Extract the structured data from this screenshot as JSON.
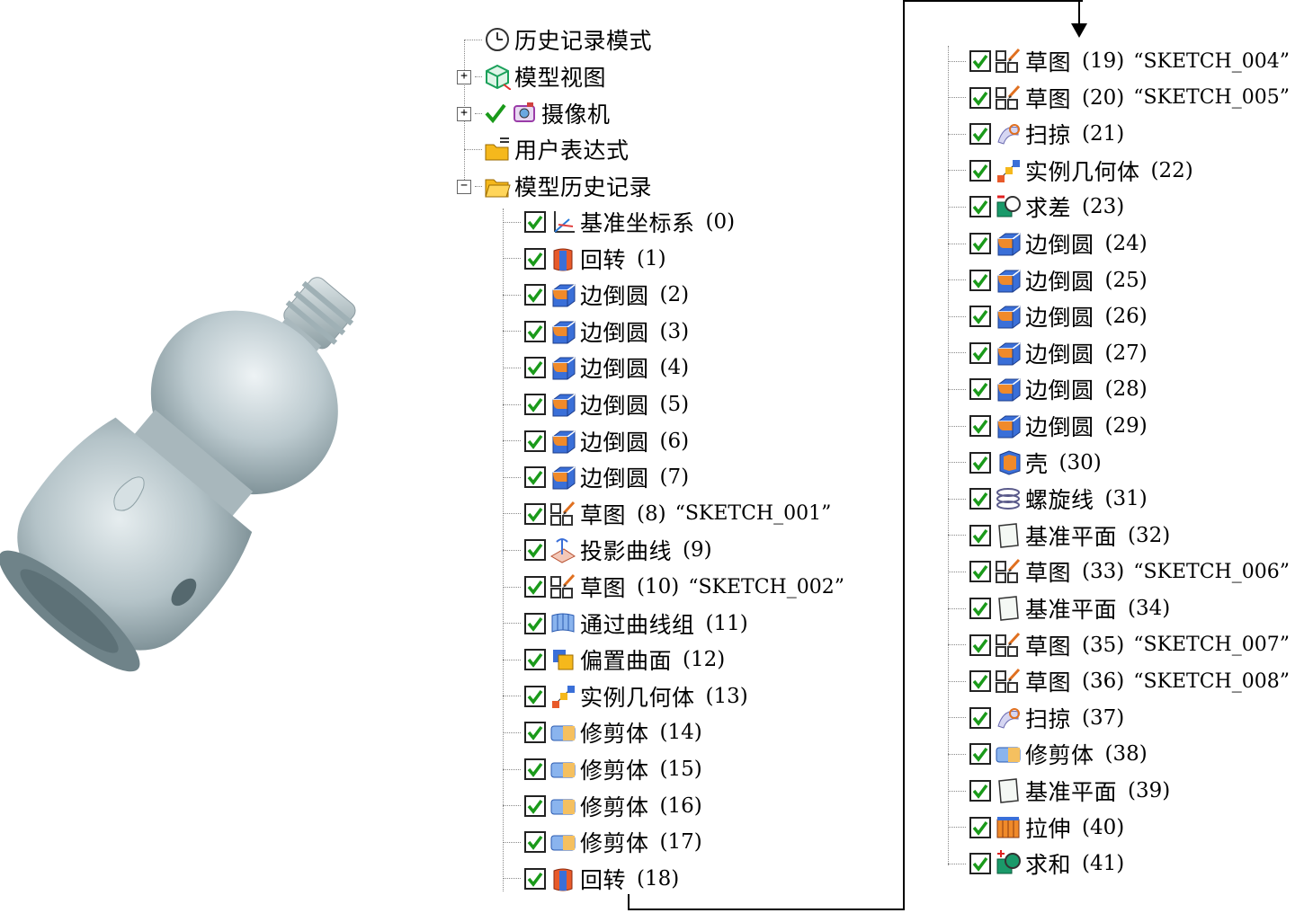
{
  "top_nodes": [
    {
      "label": "历史记录模式",
      "icon": "clock-icon",
      "expander": null
    },
    {
      "label": "模型视图",
      "icon": "model-view-icon",
      "expander": "+"
    },
    {
      "label": "摄像机",
      "icon": "camera-icon",
      "expander": "+",
      "checked": true
    },
    {
      "label": "用户表达式",
      "icon": "folder-icon",
      "expander": null
    },
    {
      "label": "模型历史记录",
      "icon": "folder-open-icon",
      "expander": "−"
    }
  ],
  "features_left": [
    {
      "name": "基准坐标系",
      "num": "(0)",
      "icon": "datum-csys-icon"
    },
    {
      "name": "回转",
      "num": "(1)",
      "icon": "revolve-icon"
    },
    {
      "name": "边倒圆",
      "num": "(2)",
      "icon": "edge-blend-icon"
    },
    {
      "name": "边倒圆",
      "num": "(3)",
      "icon": "edge-blend-icon"
    },
    {
      "name": "边倒圆",
      "num": "(4)",
      "icon": "edge-blend-icon"
    },
    {
      "name": "边倒圆",
      "num": "(5)",
      "icon": "edge-blend-icon"
    },
    {
      "name": "边倒圆",
      "num": "(6)",
      "icon": "edge-blend-icon"
    },
    {
      "name": "边倒圆",
      "num": "(7)",
      "icon": "edge-blend-icon"
    },
    {
      "name": "草图",
      "num": "(8)",
      "sketch": "“SKETCH_001”",
      "icon": "sketch-icon"
    },
    {
      "name": "投影曲线",
      "num": "(9)",
      "icon": "project-curve-icon"
    },
    {
      "name": "草图",
      "num": "(10)",
      "sketch": "“SKETCH_002”",
      "icon": "sketch-icon"
    },
    {
      "name": "通过曲线组",
      "num": "(11)",
      "icon": "through-curves-icon"
    },
    {
      "name": "偏置曲面",
      "num": "(12)",
      "icon": "offset-surface-icon"
    },
    {
      "name": "实例几何体",
      "num": "(13)",
      "icon": "instance-geometry-icon"
    },
    {
      "name": "修剪体",
      "num": "(14)",
      "icon": "trim-body-icon"
    },
    {
      "name": "修剪体",
      "num": "(15)",
      "icon": "trim-body-icon"
    },
    {
      "name": "修剪体",
      "num": "(16)",
      "icon": "trim-body-icon"
    },
    {
      "name": "修剪体",
      "num": "(17)",
      "icon": "trim-body-icon"
    },
    {
      "name": "回转",
      "num": "(18)",
      "icon": "revolve-icon"
    }
  ],
  "features_right": [
    {
      "name": "草图",
      "num": "(19)",
      "sketch": "“SKETCH_004”",
      "icon": "sketch-icon"
    },
    {
      "name": "草图",
      "num": "(20)",
      "sketch": "“SKETCH_005”",
      "icon": "sketch-icon"
    },
    {
      "name": "扫掠",
      "num": "(21)",
      "icon": "swept-icon"
    },
    {
      "name": "实例几何体",
      "num": "(22)",
      "icon": "instance-geometry-icon"
    },
    {
      "name": "求差",
      "num": "(23)",
      "icon": "subtract-icon"
    },
    {
      "name": "边倒圆",
      "num": "(24)",
      "icon": "edge-blend-icon"
    },
    {
      "name": "边倒圆",
      "num": "(25)",
      "icon": "edge-blend-icon"
    },
    {
      "name": "边倒圆",
      "num": "(26)",
      "icon": "edge-blend-icon"
    },
    {
      "name": "边倒圆",
      "num": "(27)",
      "icon": "edge-blend-icon"
    },
    {
      "name": "边倒圆",
      "num": "(28)",
      "icon": "edge-blend-icon"
    },
    {
      "name": "边倒圆",
      "num": "(29)",
      "icon": "edge-blend-icon"
    },
    {
      "name": "壳",
      "num": "(30)",
      "icon": "shell-icon"
    },
    {
      "name": "螺旋线",
      "num": "(31)",
      "icon": "helix-icon"
    },
    {
      "name": "基准平面",
      "num": "(32)",
      "icon": "datum-plane-icon"
    },
    {
      "name": "草图",
      "num": "(33)",
      "sketch": "“SKETCH_006”",
      "icon": "sketch-icon"
    },
    {
      "name": "基准平面",
      "num": "(34)",
      "icon": "datum-plane-icon"
    },
    {
      "name": "草图",
      "num": "(35)",
      "sketch": "“SKETCH_007”",
      "icon": "sketch-icon"
    },
    {
      "name": "草图",
      "num": "(36)",
      "sketch": "“SKETCH_008”",
      "icon": "sketch-icon"
    },
    {
      "name": "扫掠",
      "num": "(37)",
      "icon": "swept-icon"
    },
    {
      "name": "修剪体",
      "num": "(38)",
      "icon": "trim-body-icon"
    },
    {
      "name": "基准平面",
      "num": "(39)",
      "icon": "datum-plane-icon"
    },
    {
      "name": "拉伸",
      "num": "(40)",
      "icon": "extrude-icon"
    },
    {
      "name": "求和",
      "num": "(41)",
      "icon": "unite-icon"
    }
  ],
  "colors": {
    "check": "#1a9a1a",
    "blend_blue": "#3a6fd8",
    "blend_orange": "#f08a2a",
    "bottle": "#b9c7cc"
  }
}
